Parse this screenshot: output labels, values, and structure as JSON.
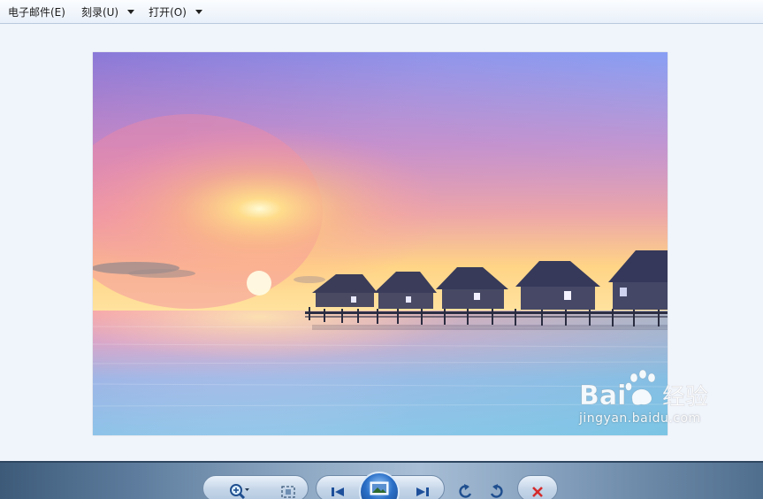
{
  "menu": {
    "items": [
      {
        "label": "电子邮件(E)",
        "has_dropdown": false
      },
      {
        "label": "刻录(U)",
        "has_dropdown": true
      },
      {
        "label": "打开(O)",
        "has_dropdown": true
      }
    ]
  },
  "photo": {
    "subject": "overwater-bungalows-sunset",
    "colors": {
      "sky_top": "#7f86e6",
      "sky_right": "#8fa4f5",
      "sky_pink": "#f08fb4",
      "horizon_glow": "#ffd37a",
      "sea": "#7fb0e0",
      "sea_light": "#9fd1ea"
    }
  },
  "toolbar": {
    "buttons": [
      {
        "name": "zoom",
        "icon": "zoom-in-icon"
      },
      {
        "name": "actual-size",
        "icon": "actual-size-icon"
      },
      {
        "name": "previous",
        "icon": "previous-icon"
      },
      {
        "name": "slideshow",
        "icon": "slideshow-icon"
      },
      {
        "name": "next",
        "icon": "next-icon"
      },
      {
        "name": "rotate-left",
        "icon": "rotate-ccw-icon"
      },
      {
        "name": "rotate-right",
        "icon": "rotate-cw-icon"
      },
      {
        "name": "delete",
        "icon": "delete-icon"
      }
    ]
  },
  "watermark": {
    "brand": "Bai  经验",
    "url": "jingyan.baidu.com"
  }
}
